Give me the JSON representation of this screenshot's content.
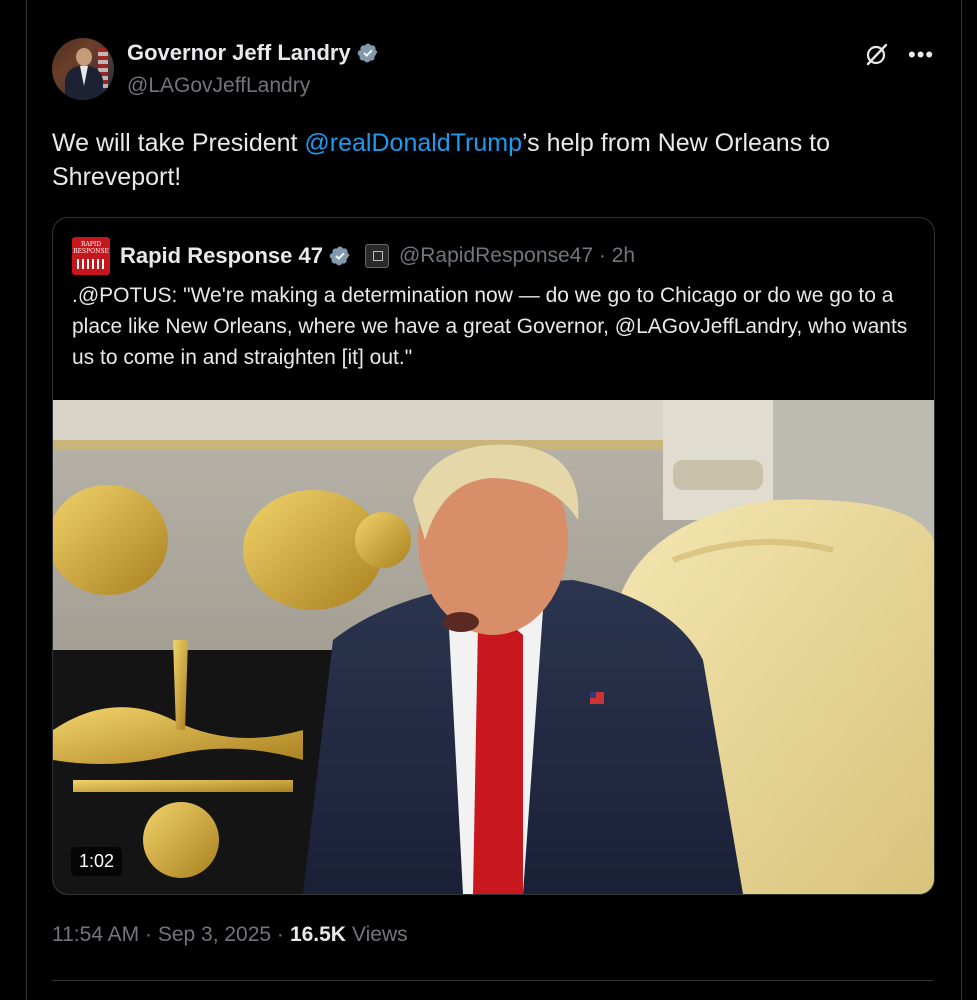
{
  "author": {
    "display_name": "Governor Jeff Landry",
    "handle": "@LAGovJeffLandry",
    "verified": true
  },
  "icons": {
    "grok": "grok-icon",
    "more": "more-icon",
    "verified": "verified-badge-icon"
  },
  "tweet": {
    "text_before": "We will take President ",
    "mention": "@realDonaldTrump",
    "text_after": "’s help from New Orleans to Shreveport!"
  },
  "quote": {
    "avatar_text": "RAPID RESPONSE",
    "display_name": "Rapid Response 47",
    "gov_badge_text": "WHITE HOUSE",
    "handle_time": "@RapidResponse47 · 2h",
    "text": ".@POTUS: \"We're making a determination now — do we go to Chicago or do we go to a place like New Orleans, where we have a great Governor, @LAGovJeffLandry, who wants us to come in and straighten [it] out.\"",
    "video_duration": "1:02"
  },
  "meta": {
    "timestamp": "11:54 AM · Sep 3, 2025 ·",
    "views_count": "16.5K",
    "views_label": "Views"
  },
  "colors": {
    "background": "#000000",
    "text": "#e7e9ea",
    "secondary": "#71767b",
    "link": "#1d9bf0",
    "verified": "#829aab"
  }
}
